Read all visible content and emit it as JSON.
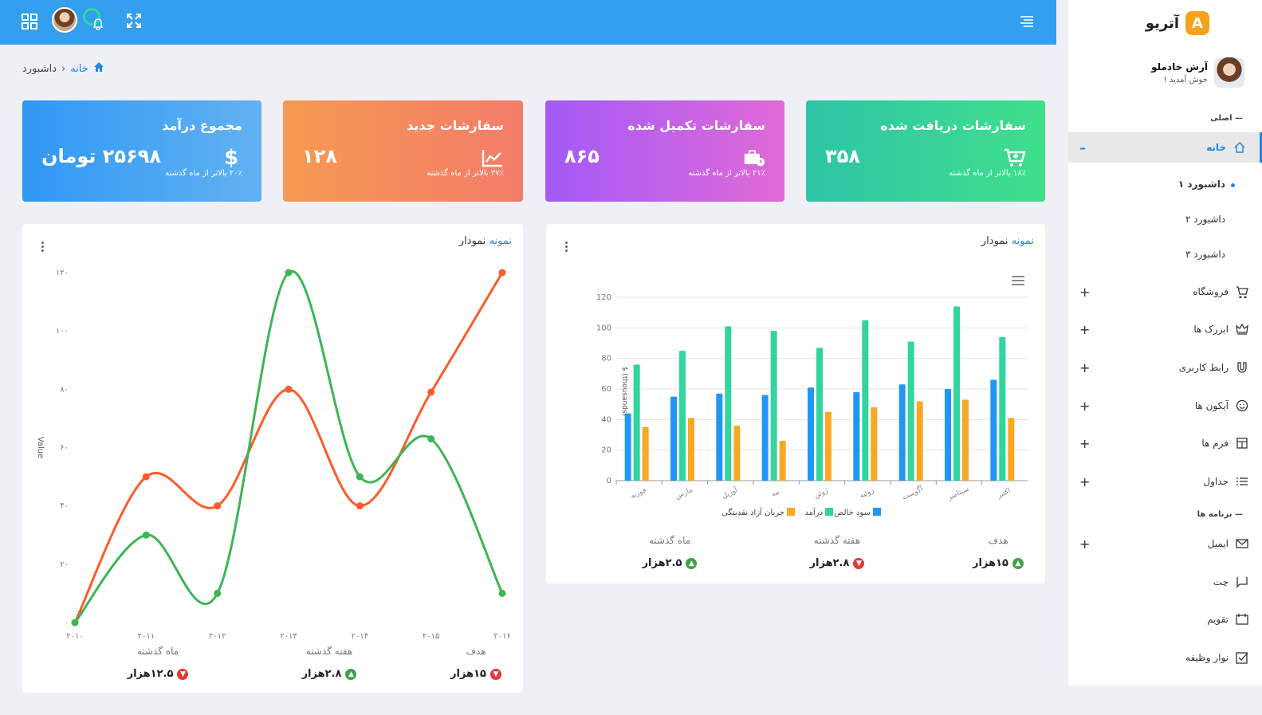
{
  "header": {
    "grid_icon": "grid-icon",
    "expand_icon": "expand-icon",
    "bell_icon": "bell-icon",
    "hamburger_icon": "hamburger-icon"
  },
  "sidebar": {
    "brand": "آتریو",
    "brand_letter": "A",
    "user": {
      "name": "آرش خادملو",
      "welcome": "خوش آمدید !"
    },
    "section_main": "اصلی",
    "section_apps": "برنامه ها",
    "home": "خانه",
    "dashboards": [
      "داشبورد ۱",
      "داشبورد ۲",
      "داشبورد ۳"
    ],
    "items": [
      {
        "label": "فروشگاه",
        "icon": "cart-icon"
      },
      {
        "label": "ابزرک ها",
        "icon": "crown-icon"
      },
      {
        "label": "رابط کاربری",
        "icon": "magnet-icon"
      },
      {
        "label": "آیکون ها",
        "icon": "smile-icon"
      },
      {
        "label": "فرم ها",
        "icon": "form-icon"
      },
      {
        "label": "جداول",
        "icon": "list-icon"
      }
    ],
    "apps": [
      {
        "label": "ایمیل",
        "icon": "mail-icon"
      },
      {
        "label": "چت",
        "icon": "chat-icon"
      },
      {
        "label": "تقویم",
        "icon": "calendar-icon"
      },
      {
        "label": "نوار وظیفه",
        "icon": "checkbox-icon"
      }
    ]
  },
  "breadcrumb": {
    "home": "خانه",
    "sep": "‹",
    "current": "داشبورد"
  },
  "cards": [
    {
      "title": "سفارشات دریافت شده",
      "value": "۳۵۸",
      "sub": "۱۸٪ بالاتر از ماه گذشته",
      "icon": "cart-icon"
    },
    {
      "title": "سفارشات تکمیل شده",
      "value": "۸۶۵",
      "sub": "۲۱٪ بالاتر از ماه گذشته",
      "icon": "briefcase-icon"
    },
    {
      "title": "سفارشات جدید",
      "value": "۱۲۸",
      "sub": "۳۷٪ بالاتر از ماه گذشته",
      "icon": "chart-icon"
    },
    {
      "title": "مجموع درآمد",
      "value": "۲۵۶۹۸ تومان",
      "sub": "۲۰٪ بالاتر از ماه گذشته",
      "icon": "dollar-icon"
    }
  ],
  "bar_panel": {
    "title_accent": "نمونه",
    "title_rest": "نمودار",
    "stats": [
      {
        "label": "هدف",
        "value": "۱۵هزار",
        "trend": "up"
      },
      {
        "label": "هفته گذشته",
        "value": "۲.۸هزار",
        "trend": "down"
      },
      {
        "label": "ماه گذشته",
        "value": "۲.۵هزار",
        "trend": "up"
      }
    ]
  },
  "line_panel": {
    "title_accent": "نمونه",
    "title_rest": "نمودار",
    "stats": [
      {
        "label": "هدف",
        "value": "۱۵هزار",
        "trend": "down"
      },
      {
        "label": "هفته گذشته",
        "value": "۲.۸هزار",
        "trend": "up"
      },
      {
        "label": "ماه گذشته",
        "value": "۱۲.۵هزار",
        "trend": "down"
      }
    ]
  },
  "colors": {
    "primary": "#349eef",
    "green": "#3db557",
    "orange": "#ff5a2c",
    "teal": "#33d4a0",
    "bar_blue": "#2196f3",
    "bar_orange": "#f9a825"
  },
  "chart_data": [
    {
      "type": "bar",
      "title": "",
      "ylabel": "$ (thousands)",
      "categories": [
        "فوریه",
        "مارس",
        "آوریل",
        "مه",
        "ژوئن",
        "ژوئیه",
        "آگوست",
        "سپتامبر",
        "اکتبر"
      ],
      "ylim": [
        0,
        120
      ],
      "yticks": [
        "0",
        "20",
        "40",
        "60",
        "80",
        "100",
        "120"
      ],
      "legend_position": "bottom",
      "series": [
        {
          "name": "سود خالص",
          "values": [
            44,
            55,
            57,
            56,
            61,
            58,
            63,
            60,
            66
          ]
        },
        {
          "name": "درآمد",
          "values": [
            76,
            85,
            101,
            98,
            87,
            105,
            91,
            114,
            94
          ]
        },
        {
          "name": "جریان آزاد نقدینگی",
          "values": [
            35,
            41,
            36,
            26,
            45,
            48,
            52,
            53,
            41
          ]
        }
      ]
    },
    {
      "type": "line",
      "title": "",
      "ylabel": "Value",
      "x": [
        "۲۰۱۰",
        "۲۰۱۱",
        "۲۰۱۲",
        "۲۰۱۳",
        "۲۰۱۴",
        "۲۰۱۵",
        "۲۰۱۶"
      ],
      "ylim": [
        0,
        120
      ],
      "yticks": [
        "۰",
        "۲۰",
        "۴۰",
        "۶۰",
        "۸۰",
        "۱۰۰",
        "۱۲۰"
      ],
      "series": [
        {
          "values": [
            0,
            50,
            40,
            80,
            40,
            79,
            120
          ]
        },
        {
          "values": [
            0,
            30,
            10,
            120,
            50,
            63,
            10
          ]
        }
      ]
    }
  ]
}
